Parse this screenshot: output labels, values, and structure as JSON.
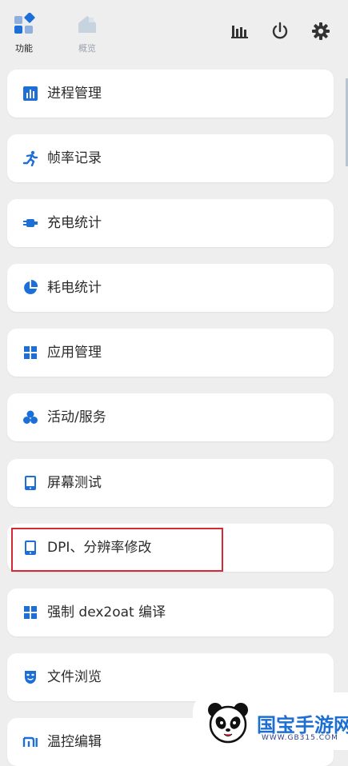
{
  "tabs": [
    {
      "label": "功能",
      "icon": "function-grid-icon",
      "active": true
    },
    {
      "label": "概览",
      "icon": "overview-house-icon",
      "active": false
    }
  ],
  "toolbar": {
    "icons": [
      "bar-chart-icon",
      "power-icon",
      "gear-icon"
    ]
  },
  "menu": {
    "items": [
      {
        "label": "进程管理",
        "icon": "bar-chart-icon"
      },
      {
        "label": "帧率记录",
        "icon": "running-figure-icon"
      },
      {
        "label": "充电统计",
        "icon": "charger-icon"
      },
      {
        "label": "耗电统计",
        "icon": "pie-chart-icon"
      },
      {
        "label": "应用管理",
        "icon": "app-grid-icon"
      },
      {
        "label": "活动/服务",
        "icon": "bubbles-icon"
      },
      {
        "label": "屏幕测试",
        "icon": "tablet-icon"
      },
      {
        "label": "DPI、分辨率修改",
        "icon": "tablet-icon"
      },
      {
        "label": "强制 dex2oat 编译",
        "icon": "app-grid-icon"
      },
      {
        "label": "文件浏览",
        "icon": "mask-icon"
      },
      {
        "label": "温控编辑",
        "icon": "mi-logo-icon"
      }
    ]
  },
  "watermark": {
    "text": "国宝手游网",
    "url_text": "WWW.GB315.COM"
  },
  "colors": {
    "accent": "#1d6fd8",
    "highlight": "#d42a35",
    "background": "#eeeeee"
  }
}
